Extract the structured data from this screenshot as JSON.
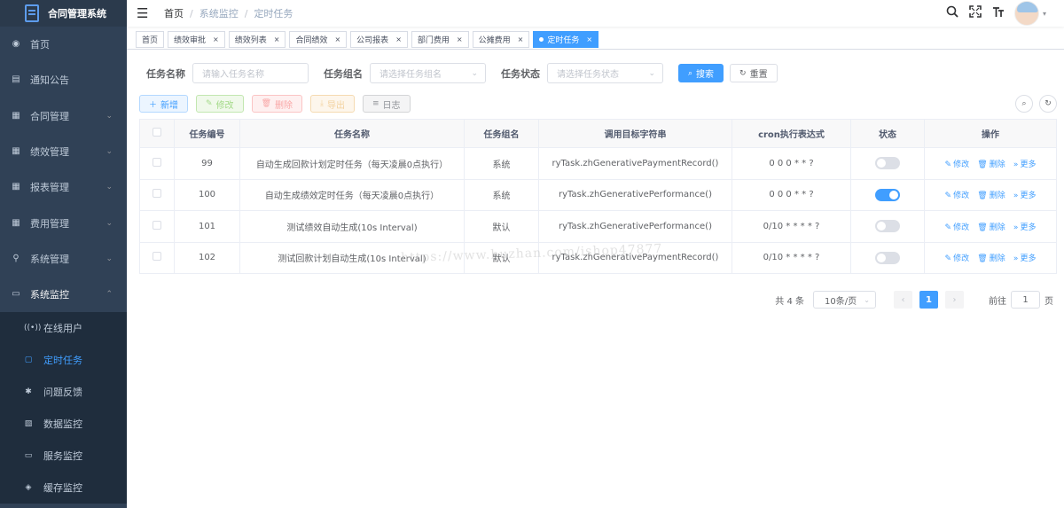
{
  "app": {
    "title": "合同管理系统"
  },
  "sidebar": {
    "items": [
      {
        "label": "首页",
        "icon": "dashboard-icon"
      },
      {
        "label": "通知公告",
        "icon": "message-icon"
      },
      {
        "label": "合同管理",
        "icon": "document-icon",
        "expandable": true
      },
      {
        "label": "绩效管理",
        "icon": "document-icon",
        "expandable": true
      },
      {
        "label": "报表管理",
        "icon": "document-icon",
        "expandable": true
      },
      {
        "label": "费用管理",
        "icon": "document-icon",
        "expandable": true
      },
      {
        "label": "系统管理",
        "icon": "system-icon",
        "expandable": true
      },
      {
        "label": "系统监控",
        "icon": "monitor-icon",
        "expandable": true,
        "open": true
      }
    ],
    "subitems": [
      {
        "label": "在线用户",
        "icon": "online-icon"
      },
      {
        "label": "定时任务",
        "icon": "job-icon",
        "active": true
      },
      {
        "label": "问题反馈",
        "icon": "bug-icon"
      },
      {
        "label": "数据监控",
        "icon": "druid-icon"
      },
      {
        "label": "服务监控",
        "icon": "server-icon"
      },
      {
        "label": "缓存监控",
        "icon": "redis-icon"
      }
    ]
  },
  "breadcrumb": {
    "items": [
      "首页",
      "系统监控",
      "定时任务"
    ]
  },
  "tags": [
    {
      "label": "首页",
      "closable": false
    },
    {
      "label": "绩效审批",
      "closable": true
    },
    {
      "label": "绩效列表",
      "closable": true
    },
    {
      "label": "合同绩效",
      "closable": true
    },
    {
      "label": "公司报表",
      "closable": true
    },
    {
      "label": "部门费用",
      "closable": true
    },
    {
      "label": "公摊费用",
      "closable": true
    },
    {
      "label": "定时任务",
      "closable": true,
      "active": true
    }
  ],
  "search": {
    "job_name_label": "任务名称",
    "job_name_placeholder": "请输入任务名称",
    "job_group_label": "任务组名",
    "job_group_placeholder": "请选择任务组名",
    "status_label": "任务状态",
    "status_placeholder": "请选择任务状态",
    "search_button": "搜索",
    "reset_button": "重置"
  },
  "toolbar": {
    "add": "新增",
    "edit": "修改",
    "delete": "删除",
    "export": "导出",
    "log": "日志"
  },
  "table": {
    "headers": [
      "任务编号",
      "任务名称",
      "任务组名",
      "调用目标字符串",
      "cron执行表达式",
      "状态",
      "操作"
    ],
    "rows": [
      {
        "id": "99",
        "name": "自动生成回款计划定时任务（每天凌晨0点执行）",
        "group": "系统",
        "target": "ryTask.zhGenerativePaymentRecord()",
        "cron": "0 0 0 * * ?",
        "enabled": false
      },
      {
        "id": "100",
        "name": "自动生成绩效定时任务（每天凌晨0点执行）",
        "group": "系统",
        "target": "ryTask.zhGenerativePerformance()",
        "cron": "0 0 0 * * ?",
        "enabled": true
      },
      {
        "id": "101",
        "name": "测试绩效自动生成(10s Interval)",
        "group": "默认",
        "target": "ryTask.zhGenerativePerformance()",
        "cron": "0/10 * * * * ?",
        "enabled": false
      },
      {
        "id": "102",
        "name": "测试回款计划自动生成(10s Interval)",
        "group": "默认",
        "target": "ryTask.zhGenerativePaymentRecord()",
        "cron": "0/10 * * * * ?",
        "enabled": false
      }
    ],
    "op_edit": "修改",
    "op_delete": "删除",
    "op_more": "更多"
  },
  "pagination": {
    "total": "共 4 条",
    "page_size": "10条/页",
    "current": "1",
    "jump_prefix": "前往",
    "jump_value": "1",
    "jump_suffix": "页"
  },
  "watermark": "https://www.huzhan.com/ishop47877",
  "colors": {
    "sidebar_bg": "#304156",
    "primary": "#409eff"
  }
}
